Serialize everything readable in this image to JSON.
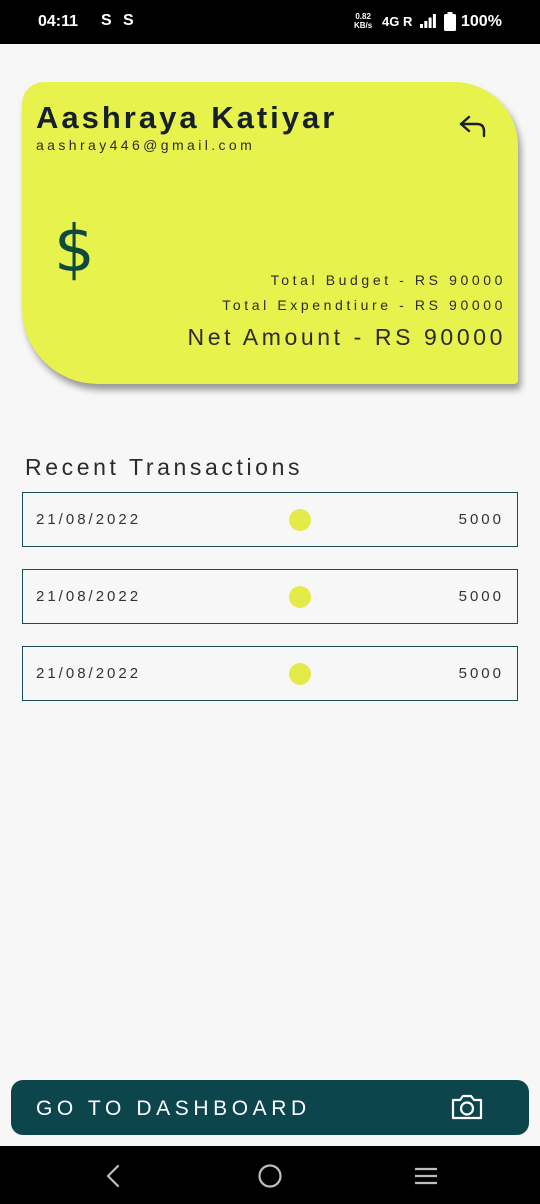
{
  "status_bar": {
    "time": "04:11",
    "notif_icons": [
      "S",
      "S"
    ],
    "speed_value": "0.82",
    "speed_unit": "KB/s",
    "network": "4G R",
    "battery": "100%"
  },
  "profile": {
    "name": "Aashraya Katiyar",
    "email": "aashray446@gmail.com",
    "currency_symbol": "$",
    "total_budget": "Total Budget - RS 90000",
    "total_expenditure": "Total Expendtiure - RS 90000",
    "net_amount": "Net Amount - RS 90000"
  },
  "transactions_section": {
    "title": "Recent Transactions",
    "items": [
      {
        "date": "21/08/2022",
        "amount": "5000"
      },
      {
        "date": "21/08/2022",
        "amount": "5000"
      },
      {
        "date": "21/08/2022",
        "amount": "5000"
      }
    ]
  },
  "dashboard_button": {
    "label": "GO TO DASHBOARD"
  },
  "colors": {
    "card": "#e8f24c",
    "primary": "#0d454c",
    "dot": "#e3ea49"
  }
}
